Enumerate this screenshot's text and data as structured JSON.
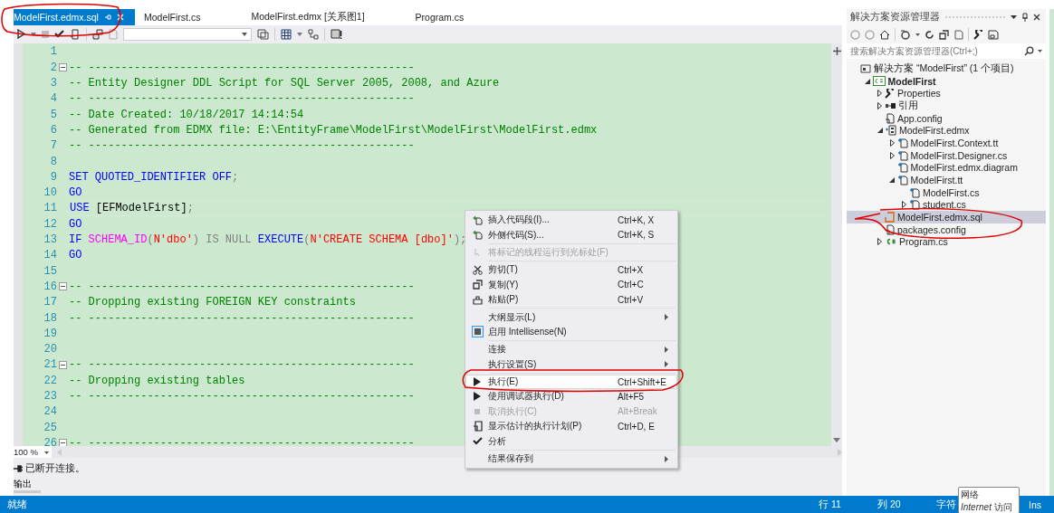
{
  "tabs": [
    {
      "label": "ModelFirst.edmx.sql",
      "selected": true
    },
    {
      "label": "ModelFirst.cs",
      "selected": false
    },
    {
      "label": "ModelFirst.edmx [关系图1]",
      "selected": false
    },
    {
      "label": "Program.cs",
      "selected": false
    }
  ],
  "code": {
    "lines": [
      {
        "number": "1",
        "fold": false,
        "current": false
      },
      {
        "number": "2",
        "fold": true,
        "current": false,
        "segments": [
          {
            "kind": "comment",
            "t": "-- --------------------------------------------------"
          }
        ]
      },
      {
        "number": "3",
        "fold": false,
        "current": false,
        "segments": [
          {
            "kind": "comment",
            "t": "-- Entity Designer DDL Script for SQL Server 2005, 2008, and Azure"
          }
        ]
      },
      {
        "number": "4",
        "fold": false,
        "current": false,
        "segments": [
          {
            "kind": "comment",
            "t": "-- --------------------------------------------------"
          }
        ]
      },
      {
        "number": "5",
        "fold": false,
        "current": false,
        "segments": [
          {
            "kind": "comment",
            "t": "-- Date Created: 10/18/2017 14:14:54"
          }
        ]
      },
      {
        "number": "6",
        "fold": false,
        "current": false,
        "segments": [
          {
            "kind": "comment",
            "t": "-- Generated from EDMX file: E:\\EntityFrame\\ModelFirst\\ModelFirst\\ModelFirst.edmx"
          }
        ]
      },
      {
        "number": "7",
        "fold": false,
        "current": false,
        "segments": [
          {
            "kind": "comment",
            "t": "-- --------------------------------------------------"
          }
        ]
      },
      {
        "number": "8",
        "fold": false,
        "current": false
      },
      {
        "number": "9",
        "fold": false,
        "current": false,
        "segments": [
          {
            "kind": "keyword",
            "t": "SET QUOTED_IDENTIFIER OFF"
          },
          {
            "kind": "op",
            "t": ";"
          }
        ]
      },
      {
        "number": "10",
        "fold": false,
        "current": false,
        "segments": [
          {
            "kind": "keyword",
            "t": "GO"
          }
        ]
      },
      {
        "number": "11",
        "fold": false,
        "current": true,
        "segments": [
          {
            "kind": "keyword",
            "t": "USE "
          },
          {
            "kind": "plain",
            "t": "[EFModelFirst]"
          },
          {
            "kind": "op",
            "t": ";"
          }
        ]
      },
      {
        "number": "12",
        "fold": false,
        "current": false,
        "segments": [
          {
            "kind": "keyword",
            "t": "GO"
          }
        ]
      },
      {
        "number": "13",
        "fold": false,
        "current": false,
        "segments": [
          {
            "kind": "keyword",
            "t": "IF "
          },
          {
            "kind": "function",
            "t": "SCHEMA_ID"
          },
          {
            "kind": "op",
            "t": "("
          },
          {
            "kind": "string",
            "t": "N'dbo'"
          },
          {
            "kind": "op",
            "t": ") IS NULL "
          },
          {
            "kind": "keyword",
            "t": "EXECUTE"
          },
          {
            "kind": "op",
            "t": "("
          },
          {
            "kind": "string",
            "t": "N'CREATE SCHEMA [dbo]'"
          },
          {
            "kind": "op",
            "t": ");"
          }
        ]
      },
      {
        "number": "14",
        "fold": false,
        "current": false,
        "segments": [
          {
            "kind": "keyword",
            "t": "GO"
          }
        ]
      },
      {
        "number": "15",
        "fold": false,
        "current": false
      },
      {
        "number": "16",
        "fold": true,
        "current": false,
        "segments": [
          {
            "kind": "comment",
            "t": "-- --------------------------------------------------"
          }
        ]
      },
      {
        "number": "17",
        "fold": false,
        "current": false,
        "segments": [
          {
            "kind": "comment",
            "t": "-- Dropping existing FOREIGN KEY constraints"
          }
        ]
      },
      {
        "number": "18",
        "fold": false,
        "current": false,
        "segments": [
          {
            "kind": "comment",
            "t": "-- --------------------------------------------------"
          }
        ]
      },
      {
        "number": "19",
        "fold": false,
        "current": false
      },
      {
        "number": "20",
        "fold": false,
        "current": false
      },
      {
        "number": "21",
        "fold": true,
        "current": false,
        "segments": [
          {
            "kind": "comment",
            "t": "-- --------------------------------------------------"
          }
        ]
      },
      {
        "number": "22",
        "fold": false,
        "current": false,
        "segments": [
          {
            "kind": "comment",
            "t": "-- Dropping existing tables"
          }
        ]
      },
      {
        "number": "23",
        "fold": false,
        "current": false,
        "segments": [
          {
            "kind": "comment",
            "t": "-- --------------------------------------------------"
          }
        ]
      },
      {
        "number": "24",
        "fold": false,
        "current": false
      },
      {
        "number": "25",
        "fold": false,
        "current": false
      },
      {
        "number": "26",
        "fold": true,
        "current": false,
        "segments": [
          {
            "kind": "comment",
            "t": "-- --------------------------------------------------"
          }
        ]
      }
    ],
    "zoom": "100 %"
  },
  "output": {
    "message": "已断开连接。",
    "tab": "输出"
  },
  "context_menu": {
    "groups": [
      [
        {
          "kind": "snippet",
          "label": "插入代码段(I)...",
          "shortcut": "Ctrl+K, X",
          "disabled": false,
          "submenu": false,
          "selected": false
        },
        {
          "kind": "snippet",
          "label": "外侧代码(S)...",
          "shortcut": "Ctrl+K, S",
          "disabled": false,
          "submenu": false,
          "selected": false
        }
      ],
      [
        {
          "kind": "pointer",
          "label": "将标记的线程运行到光标处(F)",
          "disabled": true,
          "submenu": false,
          "selected": false
        }
      ],
      [
        {
          "kind": "cut",
          "label": "剪切(T)",
          "shortcut": "Ctrl+X",
          "disabled": false,
          "submenu": false,
          "selected": false
        },
        {
          "kind": "copy",
          "label": "复制(Y)",
          "shortcut": "Ctrl+C",
          "disabled": false,
          "submenu": false,
          "selected": false
        },
        {
          "kind": "paste",
          "label": "粘贴(P)",
          "shortcut": "Ctrl+V",
          "disabled": false,
          "submenu": false,
          "selected": false
        }
      ],
      [
        {
          "kind": "none",
          "label": "大纲显示(L)",
          "disabled": false,
          "submenu": true,
          "selected": false
        },
        {
          "kind": "toggle",
          "label": "启用 Intellisense(N)",
          "disabled": false,
          "submenu": false,
          "selected": false
        }
      ],
      [
        {
          "kind": "none",
          "label": "连接",
          "disabled": false,
          "submenu": true,
          "selected": false
        },
        {
          "kind": "none",
          "label": "执行设置(S)",
          "disabled": false,
          "submenu": true,
          "selected": false
        }
      ],
      [
        {
          "kind": "run",
          "label": "执行(E)",
          "shortcut": "Ctrl+Shift+E",
          "disabled": false,
          "submenu": false,
          "selected": true
        },
        {
          "kind": "run",
          "label": "使用调试器执行(D)",
          "shortcut": "Alt+F5",
          "disabled": false,
          "submenu": false,
          "selected": false
        },
        {
          "kind": "stop",
          "label": "取消执行(C)",
          "shortcut": "Alt+Break",
          "disabled": true,
          "submenu": false,
          "selected": false
        },
        {
          "kind": "plan",
          "label": "显示估计的执行计划(P)",
          "shortcut": "Ctrl+D, E",
          "disabled": false,
          "submenu": false,
          "selected": false
        },
        {
          "kind": "check",
          "label": "分析",
          "disabled": false,
          "submenu": false,
          "selected": false
        }
      ],
      [
        {
          "kind": "none",
          "label": "结果保存到",
          "disabled": false,
          "submenu": true,
          "selected": false
        }
      ]
    ]
  },
  "solution_explorer": {
    "title": "解决方案资源管理器",
    "search": {
      "placeholder": "搜索解决方案资源管理器(Ctrl+;)"
    },
    "tree": [
      {
        "kind": "solution",
        "label": "解决方案 “ModelFirst” (1 个项目)",
        "selected": false,
        "children": [
          {
            "kind": "project",
            "label": "ModelFirst",
            "expanded": true,
            "selected": false,
            "children": [
              {
                "kind": "wrench",
                "label": "Properties",
                "expanded": false,
                "selected": false
              },
              {
                "kind": "references",
                "label": "引用",
                "expanded": false,
                "selected": false
              },
              {
                "kind": "config",
                "label": "App.config",
                "selected": false
              },
              {
                "kind": "edmx",
                "label": "ModelFirst.edmx",
                "expanded": true,
                "selected": false,
                "children": [
                  {
                    "kind": "tt",
                    "label": "ModelFirst.Context.tt",
                    "expanded": false,
                    "selected": false
                  },
                  {
                    "kind": "tt",
                    "label": "ModelFirst.Designer.cs",
                    "expanded": false,
                    "selected": false
                  },
                  {
                    "kind": "tt",
                    "label": "ModelFirst.edmx.diagram",
                    "selected": false
                  },
                  {
                    "kind": "tt",
                    "label": "ModelFirst.tt",
                    "expanded": true,
                    "selected": false,
                    "children": [
                      {
                        "kind": "tt",
                        "label": "ModelFirst.cs",
                        "selected": false
                      },
                      {
                        "kind": "tt",
                        "label": "student.cs",
                        "expanded": false,
                        "selected": false
                      }
                    ]
                  }
                ]
              },
              {
                "kind": "sql",
                "label": "ModelFirst.edmx.sql",
                "selected": true
              },
              {
                "kind": "config",
                "label": "packages.config",
                "selected": false
              },
              {
                "kind": "cs",
                "label": "Program.cs",
                "expanded": false,
                "selected": false
              }
            ]
          }
        ]
      }
    ]
  },
  "status_bar": {
    "state": "就绪",
    "line": "行 11",
    "column": "列 20",
    "char": "字符",
    "mode": "Ins"
  },
  "tooltip": {
    "title": "网络",
    "text": "*Internet* 访问"
  }
}
